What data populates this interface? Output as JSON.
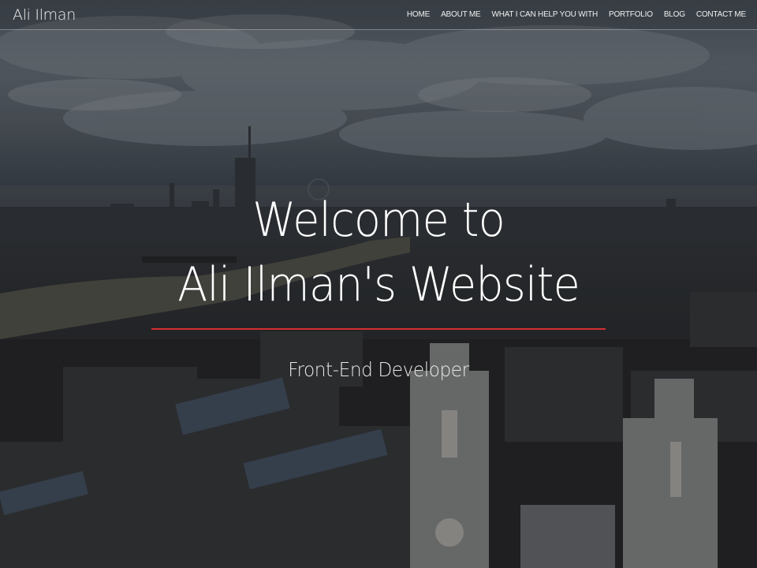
{
  "brand": {
    "name": "Ali Ilman"
  },
  "nav": {
    "items": [
      {
        "label": "HOME"
      },
      {
        "label": "ABOUT ME"
      },
      {
        "label": "WHAT I CAN HELP YOU WITH"
      },
      {
        "label": "PORTFOLIO"
      },
      {
        "label": "BLOG"
      },
      {
        "label": "CONTACT ME"
      }
    ]
  },
  "hero": {
    "title_line1": "Welcome to",
    "title_line2": "Ali Ilman's Website",
    "subtitle": "Front-End Developer",
    "divider_color": "#d32f2f",
    "background": "aerial-city-skyline-photo"
  }
}
